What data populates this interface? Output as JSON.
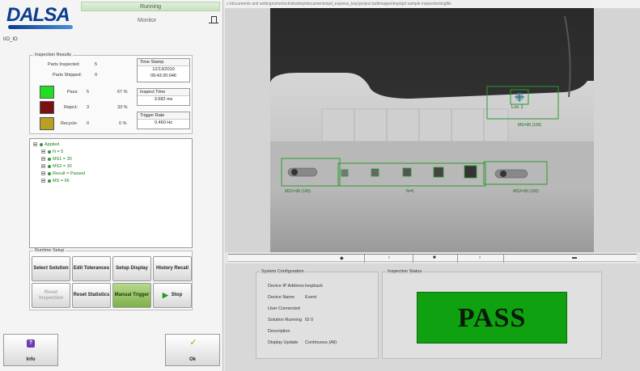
{
  "header": {
    "logo": "DALSA",
    "status": "Running",
    "mode": "Monitor",
    "io_label": "I/O_IO"
  },
  "inspection_results": {
    "title": "Inspection Results",
    "parts_inspected_label": "Parts Inspected:",
    "parts_inspected": "5",
    "parts_shipped_label": "Parts Shipped:",
    "parts_shipped": "0",
    "pass_label": "Pass:",
    "pass_count": "5",
    "pass_pct": "67 %",
    "reject_label": "Reject:",
    "reject_count": "3",
    "reject_pct": "33 %",
    "recycle_label": "Recycle:",
    "recycle_count": "0",
    "recycle_pct": "0 %",
    "colors": {
      "pass": "#22dd22",
      "reject": "#7a1010",
      "recycle": "#b8a020"
    },
    "time_stamp_label": "Time Stamp",
    "time_stamp_date": "12/13/2010",
    "time_stamp_time": "09:43:20:046",
    "inspect_time_label": "Inspect Time",
    "inspect_time": "3.682 ms",
    "trigger_rate_label": "Trigger Rate",
    "trigger_rate": "0.460 Hz"
  },
  "tree": {
    "root": "Applied",
    "items": [
      "N = 5",
      "MS1 = 30",
      "MS2 = 30",
      "Result = Passed",
      "MS = 96"
    ]
  },
  "runtime_setup": {
    "title": "Runtime Setup",
    "buttons": [
      {
        "label": "Select Solution",
        "state": "normal"
      },
      {
        "label": "Edit Tolerances",
        "state": "normal"
      },
      {
        "label": "Setup Display",
        "state": "normal"
      },
      {
        "label": "History Recall",
        "state": "normal"
      },
      {
        "label": "Reset Inspection",
        "state": "disabled"
      },
      {
        "label": "Reset Statistics",
        "state": "normal"
      },
      {
        "label": "Manual Trigger",
        "state": "active"
      },
      {
        "label": "Stop",
        "state": "normal"
      }
    ]
  },
  "footer": {
    "info_label": "Info",
    "ok_label": "Ok"
  },
  "viewer": {
    "path": "c:\\documents and settings\\sherlock\\desktop\\documents\\ipd_express_tray\\project ipd\\images\\tray\\ipd sample inspection\\logfile",
    "annotations": {
      "loc": "Loc 1",
      "ms_top": "MS=96 (100)",
      "ms1": "MS1=96 (100)",
      "n": "N=5",
      "ms2": "MS2=96 (100)"
    }
  },
  "system_configuration": {
    "title": "System Configuration",
    "rows": [
      {
        "label": "Device IP Address",
        "value": "loopback"
      },
      {
        "label": "Device Name",
        "value": "Event"
      },
      {
        "label": "User Connected",
        "value": ""
      },
      {
        "label": "Solution Running",
        "value": "ID 0"
      },
      {
        "label": "Description",
        "value": ""
      },
      {
        "label": "Display Update",
        "value": "Continuous (All)"
      }
    ]
  },
  "inspection_status": {
    "title": "Inspection Status",
    "result": "PASS",
    "color": "#0fa10f"
  }
}
